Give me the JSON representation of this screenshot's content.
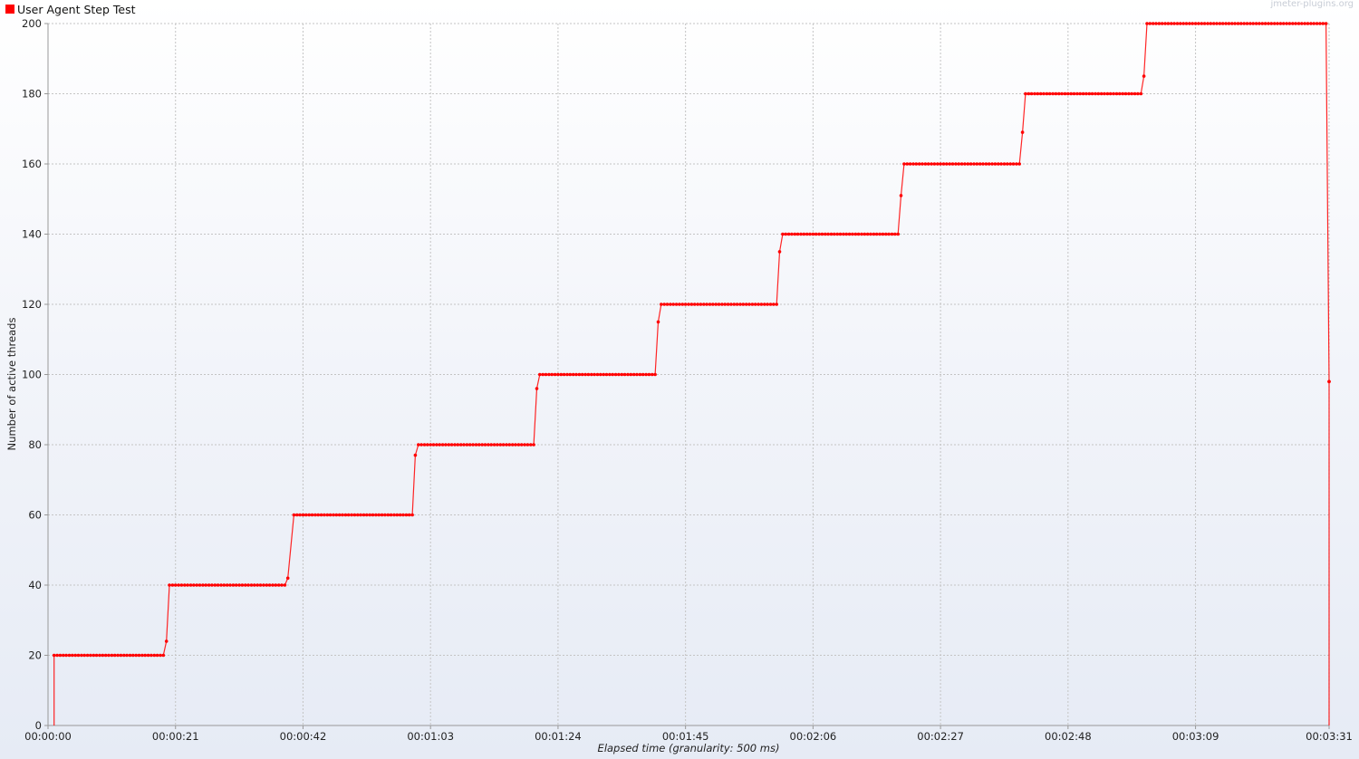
{
  "watermark": "jmeter-plugins.org",
  "chart_data": {
    "type": "line",
    "title": "",
    "xlabel": "Elapsed time (granularity: 500 ms)",
    "ylabel": "Number of active threads",
    "x_unit": "seconds",
    "xlim": [
      0,
      211
    ],
    "ylim": [
      0,
      200
    ],
    "x_ticks": [
      {
        "value": 0,
        "label": "00:00:00"
      },
      {
        "value": 21,
        "label": "00:00:21"
      },
      {
        "value": 42,
        "label": "00:00:42"
      },
      {
        "value": 63,
        "label": "00:01:03"
      },
      {
        "value": 84,
        "label": "00:01:24"
      },
      {
        "value": 105,
        "label": "00:01:45"
      },
      {
        "value": 126,
        "label": "00:02:06"
      },
      {
        "value": 147,
        "label": "00:02:27"
      },
      {
        "value": 168,
        "label": "00:02:48"
      },
      {
        "value": 189,
        "label": "00:03:09"
      },
      {
        "value": 211,
        "label": "00:03:31"
      }
    ],
    "y_ticks": [
      0,
      20,
      40,
      60,
      80,
      100,
      120,
      140,
      160,
      180,
      200
    ],
    "grid": true,
    "legend_position": "top-left",
    "marker": "dot",
    "series": [
      {
        "name": "User Agent Step Test",
        "color": "#ff0000",
        "steps": [
          {
            "from": 1.0,
            "to": 19.0,
            "value": 20
          },
          {
            "from": 20.0,
            "to": 39.0,
            "value": 40
          },
          {
            "from": 40.5,
            "to": 60.0,
            "value": 60
          },
          {
            "from": 61.0,
            "to": 80.0,
            "value": 80
          },
          {
            "from": 81.0,
            "to": 100.0,
            "value": 100
          },
          {
            "from": 101.0,
            "to": 120.0,
            "value": 120
          },
          {
            "from": 121.0,
            "to": 140.0,
            "value": 140
          },
          {
            "from": 141.0,
            "to": 160.0,
            "value": 160
          },
          {
            "from": 161.0,
            "to": 180.0,
            "value": 180
          },
          {
            "from": 181.0,
            "to": 210.5,
            "value": 200
          }
        ],
        "transitions": [
          {
            "x": 1.0,
            "y": 0
          },
          {
            "x": 19.5,
            "y": 24
          },
          {
            "x": 39.5,
            "y": 42
          },
          {
            "x": 60.5,
            "y": 77
          },
          {
            "x": 80.5,
            "y": 96
          },
          {
            "x": 100.5,
            "y": 115
          },
          {
            "x": 120.5,
            "y": 135
          },
          {
            "x": 140.5,
            "y": 151
          },
          {
            "x": 160.5,
            "y": 169
          },
          {
            "x": 180.5,
            "y": 185
          },
          {
            "x": 211.0,
            "y": 98
          },
          {
            "x": 211.0,
            "y": 0
          }
        ]
      }
    ]
  }
}
